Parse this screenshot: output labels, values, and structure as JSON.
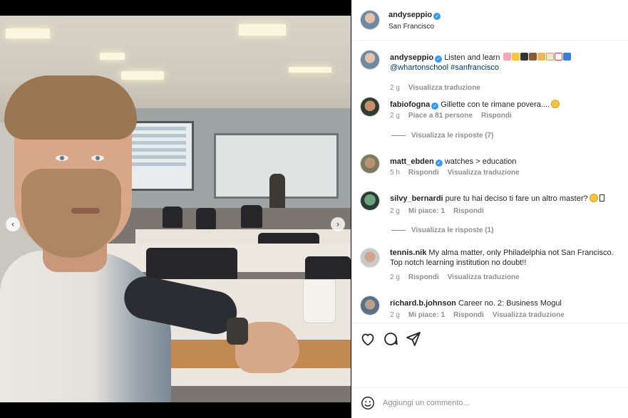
{
  "post": {
    "author": "andyseppio",
    "location": "San Francisco",
    "carousel_dots": 8,
    "carousel_active": 0
  },
  "caption": {
    "user": "andyseppio",
    "text": "Listen and learn",
    "emojis": [
      "brain",
      "school",
      "graduation-cap",
      "briefcase",
      "books",
      "notebook",
      "chart",
      "abc"
    ],
    "mention": "@whartonschool",
    "hashtag": "#sanfrancisco",
    "time": "2 g",
    "translate": "Visualizza traduzione"
  },
  "comments": [
    {
      "user": "fabiofogna",
      "verified": true,
      "text": "Gillette con te rimane povera....",
      "emoji": "laughing",
      "time": "2 g",
      "likes": "Piace a 81 persone",
      "reply": "Rispondi",
      "translate": "",
      "view_replies": "Visualizza le risposte (7)"
    },
    {
      "user": "matt_ebden",
      "verified": true,
      "text": "watches > education",
      "time": "5 h",
      "likes": "",
      "reply": "Rispondi",
      "translate": "Visualizza traduzione",
      "view_replies": ""
    },
    {
      "user": "silvy_bernardi",
      "verified": false,
      "text": "pure tu hai deciso ti fare un altro master?",
      "emoji": "laughing",
      "time": "2 g",
      "likes": "Mi piace: 1",
      "reply": "Rispondi",
      "translate": "",
      "view_replies": "Visualizza le risposte (1)"
    },
    {
      "user": "tennis.nik",
      "verified": false,
      "text": "My alma matter, only Philadelphia not San Francisco. Top notch learning institution no doubt!!",
      "time": "2 g",
      "likes": "",
      "reply": "Rispondi",
      "translate": "Visualizza traduzione",
      "view_replies": ""
    },
    {
      "user": "richard.b.johnson",
      "verified": false,
      "text": "Career no. 2: Business Mogul",
      "time": "2 g",
      "likes": "Mi piace: 1",
      "reply": "Rispondi",
      "translate": "Visualizza traduzione",
      "view_replies": ""
    }
  ],
  "actions": {
    "like_icon": "heart-icon",
    "comment_icon": "comment-icon",
    "share_icon": "send-icon"
  },
  "composer": {
    "placeholder": "Aggiungi un commento..."
  },
  "colors": {
    "verified": "#3897f0",
    "link": "#00376b",
    "muted": "#8e8e8e"
  }
}
